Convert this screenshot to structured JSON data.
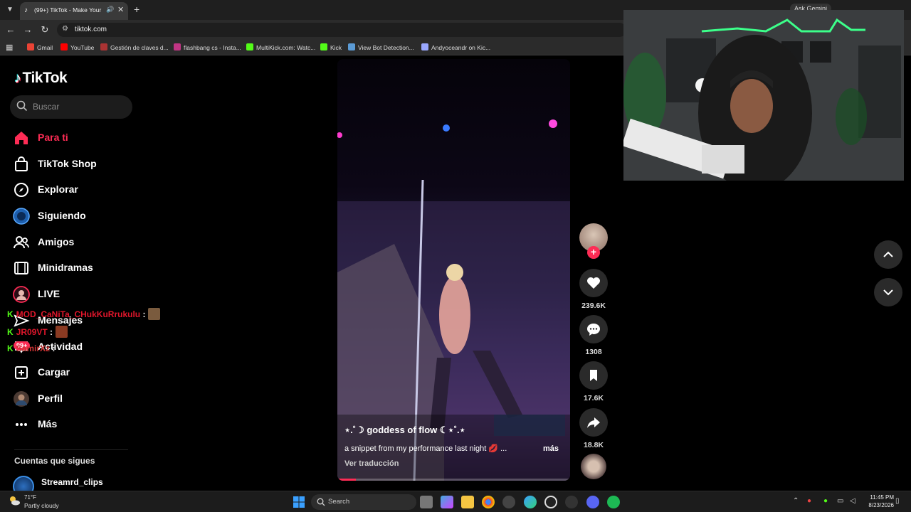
{
  "browser": {
    "tab_title": "(99+) TikTok - Make Your Day",
    "url": "tiktok.com",
    "ask_gemini": "Ask Gemini",
    "bookmarks": [
      {
        "label": "Gmail",
        "color": "#ea4335"
      },
      {
        "label": "YouTube",
        "color": "#ff0000"
      },
      {
        "label": "Gestión de claves d...",
        "color": "#e44"
      },
      {
        "label": "flashbang cs - Insta...",
        "color": "#c13584"
      },
      {
        "label": "MultiKick.com: Watc...",
        "color": "#53fc18"
      },
      {
        "label": "Kick",
        "color": "#53fc18"
      },
      {
        "label": "View Bot Detection...",
        "color": "#5b9bd5"
      },
      {
        "label": "Andyoceandr on Kic...",
        "color": "#9aa8ff"
      }
    ]
  },
  "tiktok": {
    "logo": "TikTok",
    "search_placeholder": "Buscar",
    "nav": [
      {
        "label": "Para ti",
        "icon": "home-icon",
        "active": true
      },
      {
        "label": "TikTok Shop",
        "icon": "shop-bag-icon"
      },
      {
        "label": "Explorar",
        "icon": "compass-icon"
      },
      {
        "label": "Siguiendo",
        "icon": "following-avatar-icon"
      },
      {
        "label": "Amigos",
        "icon": "friends-icon"
      },
      {
        "label": "Minidramas",
        "icon": "film-icon"
      },
      {
        "label": "LIVE",
        "icon": "live-icon"
      },
      {
        "label": "Mensajes",
        "icon": "message-icon"
      },
      {
        "label": "Actividad",
        "icon": "activity-icon"
      },
      {
        "label": "Cargar",
        "icon": "upload-icon"
      },
      {
        "label": "Perfil",
        "icon": "profile-avatar-icon"
      },
      {
        "label": "Más",
        "icon": "more-icon"
      }
    ],
    "notification_badge": "99+",
    "following_header": "Cuentas que sigues",
    "following_accounts": [
      {
        "name": "Streamrd_clips"
      }
    ]
  },
  "chat": [
    {
      "user": "MOD_CaNiTa_CHukKuRrukulu",
      "colon": ":"
    },
    {
      "user": "JR09VT",
      "colon": ":"
    },
    {
      "user": "SamirXz",
      "colon": ":"
    }
  ],
  "video": {
    "title": "⋆.˚☽ goddess of flow ☾⋆˚.⋆",
    "caption": "a snippet from my performance last night 💋 ...",
    "more": "más",
    "translate": "Ver traducción",
    "progress": 0.08
  },
  "actions": {
    "likes": "239.6K",
    "comments": "1308",
    "saves": "17.6K",
    "shares": "18.8K"
  },
  "taskbar": {
    "temp": "71°F",
    "weather": "Partly cloudy",
    "search": "Search",
    "time": "11:45 PM",
    "date": "8/23/2026"
  }
}
